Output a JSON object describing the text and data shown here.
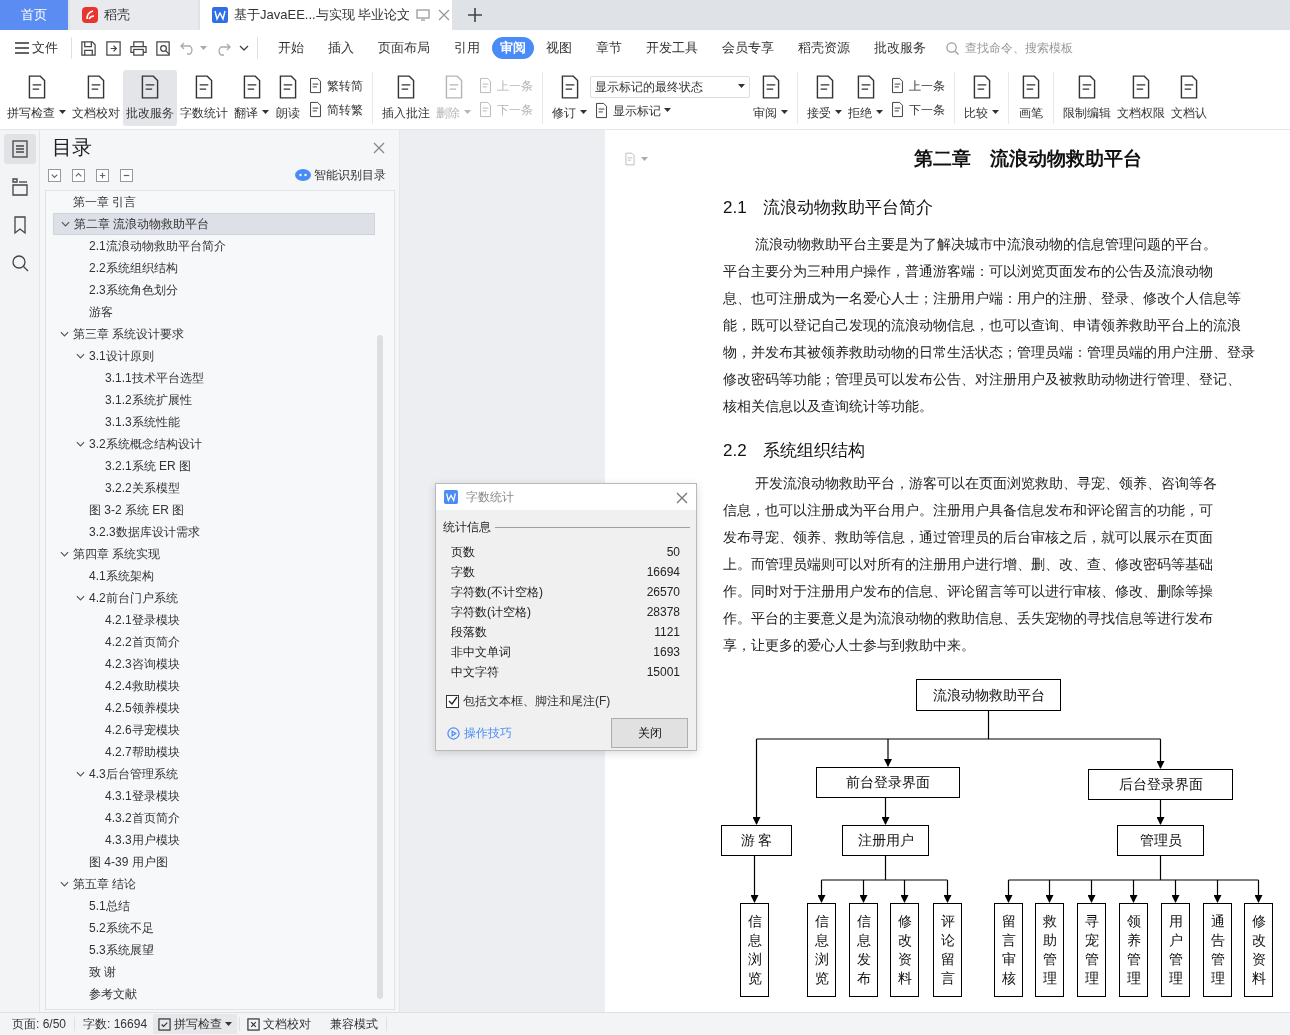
{
  "tabs": [
    {
      "label": "首页",
      "kind": "home",
      "selected": false
    },
    {
      "label": "稻壳",
      "kind": "app",
      "selected": false
    },
    {
      "label": "基于JavaEE...与实现 毕业论文",
      "kind": "document",
      "selected": true
    }
  ],
  "menu": {
    "file": "文件",
    "items": [
      {
        "label": "开始",
        "selected": false
      },
      {
        "label": "插入",
        "selected": false
      },
      {
        "label": "页面布局",
        "selected": false
      },
      {
        "label": "引用",
        "selected": false
      },
      {
        "label": "审阅",
        "selected": true
      },
      {
        "label": "视图",
        "selected": false
      },
      {
        "label": "章节",
        "selected": false
      },
      {
        "label": "开发工具",
        "selected": false
      },
      {
        "label": "会员专享",
        "selected": false
      },
      {
        "label": "稻壳资源",
        "selected": false
      },
      {
        "label": "批改服务",
        "selected": false
      }
    ],
    "search": {
      "placeholder": "查找命令、搜索模板"
    }
  },
  "ribbon": [
    {
      "kind": "large",
      "label": "拼写检查",
      "dropdown": true,
      "selected": false,
      "disabled": false
    },
    {
      "kind": "large",
      "label": "文档校对",
      "dropdown": false,
      "selected": false,
      "disabled": false
    },
    {
      "kind": "large",
      "label": "批改服务",
      "dropdown": false,
      "selected": true,
      "disabled": false
    },
    {
      "kind": "large",
      "label": "字数统计",
      "dropdown": false,
      "selected": false,
      "disabled": false
    },
    {
      "kind": "large",
      "label": "翻译",
      "dropdown": true,
      "selected": false,
      "disabled": false
    },
    {
      "kind": "large",
      "label": "朗读",
      "dropdown": false,
      "selected": false,
      "disabled": false
    },
    {
      "kind": "pair",
      "items": [
        {
          "label": "繁转简",
          "disabled": false
        },
        {
          "label": "简转繁",
          "disabled": false
        }
      ]
    },
    {
      "kind": "separator"
    },
    {
      "kind": "large",
      "label": "插入批注",
      "dropdown": false,
      "selected": false,
      "disabled": false
    },
    {
      "kind": "large",
      "label": "删除",
      "dropdown": true,
      "selected": false,
      "disabled": true
    },
    {
      "kind": "pair",
      "items": [
        {
          "label": "上一条",
          "disabled": true
        },
        {
          "label": "下一条",
          "disabled": true
        }
      ]
    },
    {
      "kind": "separator"
    },
    {
      "kind": "large",
      "label": "修订",
      "dropdown": true,
      "selected": false,
      "disabled": false
    },
    {
      "kind": "select",
      "value": "显示标记的最终状态",
      "label": "显示标记"
    },
    {
      "kind": "large",
      "label": "审阅",
      "dropdown": true,
      "selected": false,
      "disabled": false
    },
    {
      "kind": "separator"
    },
    {
      "kind": "large",
      "label": "接受",
      "dropdown": true,
      "selected": false,
      "disabled": false
    },
    {
      "kind": "large",
      "label": "拒绝",
      "dropdown": true,
      "selected": false,
      "disabled": false
    },
    {
      "kind": "pair",
      "items": [
        {
          "label": "上一条",
          "disabled": false
        },
        {
          "label": "下一条",
          "disabled": false
        }
      ]
    },
    {
      "kind": "separator"
    },
    {
      "kind": "large",
      "label": "比较",
      "dropdown": true,
      "selected": false,
      "disabled": false
    },
    {
      "kind": "separator"
    },
    {
      "kind": "large",
      "label": "画笔",
      "dropdown": false,
      "selected": false,
      "disabled": false
    },
    {
      "kind": "separator"
    },
    {
      "kind": "large",
      "label": "限制编辑",
      "dropdown": false,
      "selected": false,
      "disabled": false
    },
    {
      "kind": "large",
      "label": "文档权限",
      "dropdown": false,
      "selected": false,
      "disabled": false
    },
    {
      "kind": "large",
      "label": "文档认",
      "dropdown": false,
      "selected": false,
      "disabled": false
    }
  ],
  "side_tabs": [
    {
      "selected": true
    },
    {
      "selected": false
    },
    {
      "selected": false
    },
    {
      "selected": false
    }
  ],
  "toc": {
    "title": "目录",
    "smart_label": "智能识别目录",
    "items": [
      {
        "label": "第一章 引言",
        "selected": false
      },
      {
        "label": "第二章 流浪动物救助平台",
        "selected": true,
        "expanded": true,
        "children": [
          {
            "label": "2.1流浪动物救助平台简介",
            "selected": false
          },
          {
            "label": "2.2系统组织结构",
            "selected": false
          },
          {
            "label": "2.3系统角色划分",
            "selected": false
          },
          {
            "label": "游客",
            "selected": false
          }
        ]
      },
      {
        "label": "第三章 系统设计要求",
        "selected": false,
        "expanded": true,
        "children": [
          {
            "label": "3.1设计原则",
            "selected": false,
            "expanded": true,
            "children": [
              {
                "label": "3.1.1技术平台选型",
                "selected": false
              },
              {
                "label": "3.1.2系统扩展性",
                "selected": false
              },
              {
                "label": "3.1.3系统性能",
                "selected": false
              }
            ]
          },
          {
            "label": "3.2系统概念结构设计",
            "selected": false,
            "expanded": true,
            "children": [
              {
                "label": "3.2.1系统 ER 图",
                "selected": false
              },
              {
                "label": "3.2.2关系模型",
                "selected": false
              }
            ]
          },
          {
            "label": "图 3-2 系统 ER 图",
            "selected": false
          },
          {
            "label": "3.2.3数据库设计需求",
            "selected": false
          }
        ]
      },
      {
        "label": "第四章 系统实现",
        "selected": false,
        "expanded": true,
        "children": [
          {
            "label": "4.1系统架构",
            "selected": false
          },
          {
            "label": "4.2前台门户系统",
            "selected": false,
            "expanded": true,
            "children": [
              {
                "label": "4.2.1登录模块",
                "selected": false
              },
              {
                "label": "4.2.2首页简介",
                "selected": false
              },
              {
                "label": "4.2.3咨询模块",
                "selected": false
              },
              {
                "label": "4.2.4救助模块",
                "selected": false
              },
              {
                "label": "4.2.5领养模块",
                "selected": false
              },
              {
                "label": "4.2.6寻宠模块",
                "selected": false
              },
              {
                "label": "4.2.7帮助模块",
                "selected": false
              }
            ]
          },
          {
            "label": "4.3后台管理系统",
            "selected": false,
            "expanded": true,
            "children": [
              {
                "label": "4.3.1登录模块",
                "selected": false
              },
              {
                "label": "4.3.2首页简介",
                "selected": false
              },
              {
                "label": "4.3.3用户模块",
                "selected": false
              }
            ]
          },
          {
            "label": "图 4-39 用户图",
            "selected": false
          }
        ]
      },
      {
        "label": "第五章 结论",
        "selected": false,
        "expanded": true,
        "children": [
          {
            "label": "5.1总结",
            "selected": false
          },
          {
            "label": "5.2系统不足",
            "selected": false
          },
          {
            "label": "5.3系统展望",
            "selected": false
          },
          {
            "label": "致 谢",
            "selected": false
          },
          {
            "label": "参考文献",
            "selected": false
          }
        ]
      }
    ]
  },
  "document": {
    "chapter_title": "第二章　流浪动物救助平台",
    "sections": [
      {
        "number": "2.1",
        "title": "流浪动物救助平台简介",
        "lines": [
          "流浪动物救助平台主要是为了解决城市中流浪动物的信息管理问题的平台。",
          "平台主要分为三种用户操作，普通游客端：可以浏览页面发布的公告及流浪动物",
          "息、也可注册成为一名爱心人士；注册用户端：用户的注册、登录、修改个人信息等",
          "能，既可以登记自己发现的流浪动物信息，也可以查询、申请领养救助平台上的流浪",
          "物，并发布其被领养救助动物的日常生活状态；管理员端：管理员端的用户注册、登录",
          "修改密码等功能；管理员可以发布公告、对注册用户及被救助动物进行管理、登记、",
          "核相关信息以及查询统计等功能。"
        ]
      },
      {
        "number": "2.2",
        "title": "系统组织结构",
        "lines": [
          "开发流浪动物救助平台，游客可以在页面浏览救助、寻宠、领养、咨询等各",
          "信息，也可以注册成为平台用户。注册用户具备信息发布和评论留言的功能，可",
          "发布寻宠、领养、救助等信息，通过管理员的后台审核之后，就可以展示在页面",
          "上。而管理员端则可以对所有的注册用户进行增、删、改、查、修改密码等基础",
          "作。同时对于注册用户发布的信息、评论留言等可以进行审核、修改、删除等操",
          "作。平台的主要意义是为流浪动物的救助信息、丢失宠物的寻找信息等进行发布",
          "享，让更多的爱心人士参与到救助中来。"
        ]
      }
    ],
    "org_chart": {
      "label": "流浪动物救助平台",
      "children": [
        {
          "label": "游 客",
          "children": [
            {
              "label": "信息浏览"
            }
          ]
        },
        {
          "label": "前台登录界面",
          "children": [
            {
              "label": "注册用户",
              "children": [
                {
                  "label": "信息浏览"
                },
                {
                  "label": "信息发布"
                },
                {
                  "label": "修改资料"
                },
                {
                  "label": "评论留言"
                }
              ]
            }
          ]
        },
        {
          "label": "后台登录界面",
          "children": [
            {
              "label": "管理员",
              "children": [
                {
                  "label": "留言审核"
                },
                {
                  "label": "救助管理"
                },
                {
                  "label": "寻宠管理"
                },
                {
                  "label": "领养管理"
                },
                {
                  "label": "用户管理"
                },
                {
                  "label": "通告管理"
                },
                {
                  "label": "修改资料"
                }
              ]
            }
          ]
        }
      ]
    }
  },
  "dialog": {
    "title": "字数统计",
    "group": "统计信息",
    "rows": [
      {
        "label": "页数",
        "value": "50"
      },
      {
        "label": "字数",
        "value": "16694"
      },
      {
        "label": "字符数(不计空格)",
        "value": "26570"
      },
      {
        "label": "字符数(计空格)",
        "value": "28378"
      },
      {
        "label": "段落数",
        "value": "1121"
      },
      {
        "label": "非中文单词",
        "value": "1693"
      },
      {
        "label": "中文字符",
        "value": "15001"
      }
    ],
    "checkbox": {
      "label": "包括文本框、脚注和尾注(F)",
      "checked": true
    },
    "tips_link": "操作技巧",
    "close_button": "关闭"
  },
  "status_bar": {
    "page": "页面: 6/50",
    "words": "字数: 16694",
    "spell_check": "拼写检查",
    "proofread": "文档校对",
    "mode": "兼容模式"
  }
}
